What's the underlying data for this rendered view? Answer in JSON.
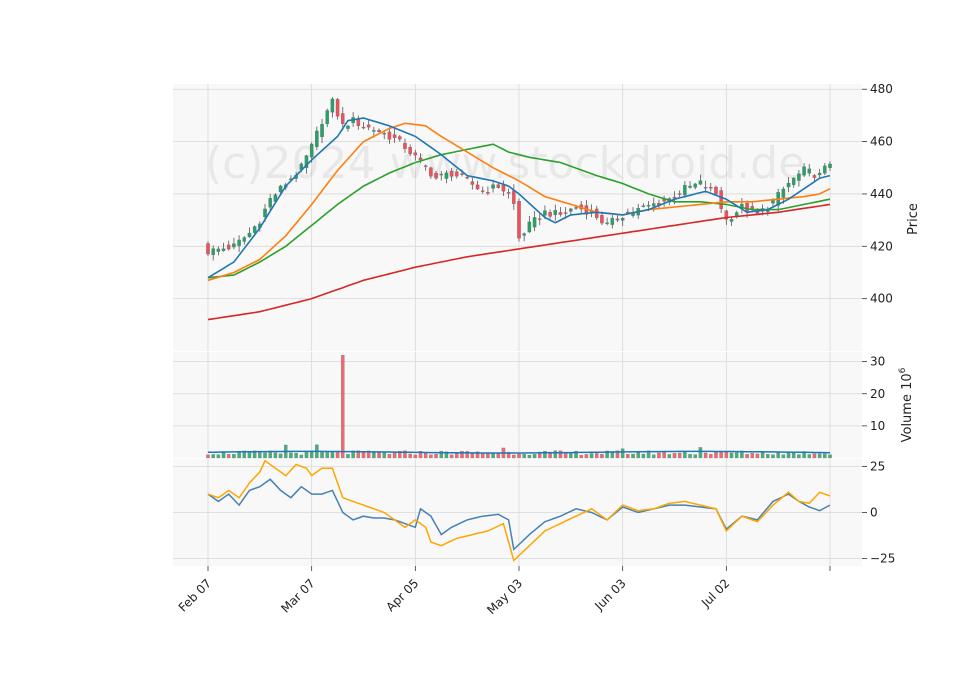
{
  "watermark": "(c)2024 www.stockdroid.de",
  "colors": {
    "up": "#26a269",
    "down": "#f0505a",
    "bg": "#f8f8f8",
    "grid": "#d8d8d8",
    "ma_blue": "#1f77b4",
    "ma_orange": "#ff7f0e",
    "ma_green": "#2ca02c",
    "ma_red": "#d62728",
    "osc_blue": "#4682b4",
    "osc_orange": "#ffa500",
    "vol_line": "#1f77b4"
  },
  "chart_data": [
    {
      "type": "candlestick",
      "ylabel": "Price",
      "ylim": [
        380,
        482
      ],
      "yticks": [
        400,
        420,
        440,
        460,
        480
      ],
      "xticks": [
        {
          "i": 0,
          "label": "Feb 07"
        },
        {
          "i": 20,
          "label": "Mar 07"
        },
        {
          "i": 40,
          "label": "Apr 05"
        },
        {
          "i": 60,
          "label": "May 03"
        },
        {
          "i": 80,
          "label": "Jun 03"
        },
        {
          "i": 100,
          "label": "Jul 02"
        },
        {
          "i": 120,
          "label": ""
        }
      ],
      "close_anchors": [
        [
          0,
          418
        ],
        [
          5,
          420
        ],
        [
          8,
          425
        ],
        [
          10,
          430
        ],
        [
          12,
          438
        ],
        [
          15,
          444
        ],
        [
          18,
          450
        ],
        [
          20,
          458
        ],
        [
          22,
          468
        ],
        [
          24,
          475
        ],
        [
          26,
          466
        ],
        [
          28,
          468
        ],
        [
          30,
          466
        ],
        [
          33,
          464
        ],
        [
          36,
          461
        ],
        [
          38,
          458
        ],
        [
          41,
          452
        ],
        [
          44,
          446
        ],
        [
          47,
          448
        ],
        [
          50,
          445
        ],
        [
          53,
          441
        ],
        [
          56,
          443
        ],
        [
          58,
          440
        ],
        [
          59,
          436
        ],
        [
          60,
          423
        ],
        [
          62,
          428
        ],
        [
          65,
          433
        ],
        [
          68,
          432
        ],
        [
          71,
          435
        ],
        [
          74,
          433
        ],
        [
          77,
          428
        ],
        [
          80,
          432
        ],
        [
          83,
          434
        ],
        [
          86,
          436
        ],
        [
          89,
          438
        ],
        [
          92,
          442
        ],
        [
          95,
          444
        ],
        [
          98,
          440
        ],
        [
          100,
          430
        ],
        [
          103,
          435
        ],
        [
          106,
          432
        ],
        [
          109,
          437
        ],
        [
          112,
          444
        ],
        [
          115,
          449
        ],
        [
          118,
          447
        ],
        [
          120,
          452
        ]
      ],
      "ma_blue": [
        [
          0,
          408
        ],
        [
          5,
          414
        ],
        [
          10,
          427
        ],
        [
          15,
          443
        ],
        [
          20,
          453
        ],
        [
          25,
          462
        ],
        [
          27,
          468
        ],
        [
          30,
          469
        ],
        [
          35,
          466
        ],
        [
          40,
          462
        ],
        [
          45,
          455
        ],
        [
          50,
          447
        ],
        [
          55,
          445
        ],
        [
          58,
          443
        ],
        [
          60,
          440
        ],
        [
          65,
          431
        ],
        [
          67,
          429
        ],
        [
          70,
          432
        ],
        [
          75,
          433
        ],
        [
          80,
          432
        ],
        [
          85,
          434
        ],
        [
          90,
          438
        ],
        [
          96,
          441
        ],
        [
          100,
          438
        ],
        [
          104,
          433
        ],
        [
          108,
          434
        ],
        [
          112,
          438
        ],
        [
          115,
          442
        ],
        [
          118,
          446
        ],
        [
          120,
          447
        ]
      ],
      "ma_orange": [
        [
          0,
          407
        ],
        [
          5,
          410
        ],
        [
          10,
          415
        ],
        [
          15,
          424
        ],
        [
          20,
          436
        ],
        [
          25,
          449
        ],
        [
          30,
          460
        ],
        [
          35,
          465
        ],
        [
          38,
          467
        ],
        [
          42,
          466
        ],
        [
          45,
          462
        ],
        [
          50,
          456
        ],
        [
          55,
          450
        ],
        [
          60,
          445
        ],
        [
          65,
          439
        ],
        [
          70,
          436
        ],
        [
          75,
          433
        ],
        [
          80,
          432
        ],
        [
          85,
          434
        ],
        [
          90,
          435
        ],
        [
          95,
          436
        ],
        [
          100,
          437
        ],
        [
          105,
          437
        ],
        [
          110,
          438
        ],
        [
          115,
          439
        ],
        [
          118,
          440
        ],
        [
          120,
          442
        ]
      ],
      "ma_green": [
        [
          0,
          408
        ],
        [
          5,
          409
        ],
        [
          10,
          414
        ],
        [
          15,
          420
        ],
        [
          20,
          428
        ],
        [
          25,
          436
        ],
        [
          30,
          443
        ],
        [
          35,
          448
        ],
        [
          40,
          452
        ],
        [
          45,
          455
        ],
        [
          50,
          457
        ],
        [
          55,
          459
        ],
        [
          58,
          456
        ],
        [
          62,
          454
        ],
        [
          68,
          452
        ],
        [
          75,
          447
        ],
        [
          80,
          444
        ],
        [
          85,
          440
        ],
        [
          90,
          437
        ],
        [
          95,
          437
        ],
        [
          100,
          436
        ],
        [
          105,
          434
        ],
        [
          110,
          434
        ],
        [
          115,
          436
        ],
        [
          120,
          438
        ]
      ],
      "ma_red": [
        [
          0,
          392
        ],
        [
          10,
          395
        ],
        [
          20,
          400
        ],
        [
          30,
          407
        ],
        [
          40,
          412
        ],
        [
          50,
          416
        ],
        [
          60,
          419
        ],
        [
          70,
          422
        ],
        [
          80,
          425
        ],
        [
          90,
          428
        ],
        [
          100,
          431
        ],
        [
          110,
          433
        ],
        [
          120,
          436
        ]
      ]
    },
    {
      "type": "bar",
      "ylabel": "Volume  10",
      "ylabel_exp": "6",
      "ylim": [
        0,
        33
      ],
      "yticks": [
        10,
        20,
        30
      ],
      "spike": {
        "i": 26,
        "value": 32
      },
      "ma_level": 1.8
    },
    {
      "type": "line",
      "ylim": [
        -29,
        29
      ],
      "yticks": [
        -25,
        0,
        25
      ],
      "yticklabels": [
        "−25",
        "0",
        "25"
      ],
      "series": [
        {
          "color": "osc_blue",
          "anchors": [
            [
              0,
              10
            ],
            [
              2,
              6
            ],
            [
              4,
              10
            ],
            [
              6,
              4
            ],
            [
              8,
              12
            ],
            [
              10,
              14
            ],
            [
              12,
              18
            ],
            [
              14,
              12
            ],
            [
              16,
              8
            ],
            [
              18,
              14
            ],
            [
              20,
              10
            ],
            [
              22,
              10
            ],
            [
              24,
              12
            ],
            [
              26,
              0
            ],
            [
              28,
              -4
            ],
            [
              30,
              -2
            ],
            [
              32,
              -3
            ],
            [
              34,
              -3
            ],
            [
              36,
              -4
            ],
            [
              38,
              -6
            ],
            [
              40,
              -8
            ],
            [
              41,
              2
            ],
            [
              43,
              -2
            ],
            [
              45,
              -12
            ],
            [
              47,
              -8
            ],
            [
              50,
              -4
            ],
            [
              53,
              -2
            ],
            [
              56,
              -1
            ],
            [
              58,
              -4
            ],
            [
              59,
              -20
            ],
            [
              62,
              -12
            ],
            [
              65,
              -5
            ],
            [
              68,
              -2
            ],
            [
              71,
              2
            ],
            [
              74,
              0
            ],
            [
              77,
              -4
            ],
            [
              80,
              3
            ],
            [
              83,
              0
            ],
            [
              86,
              2
            ],
            [
              89,
              4
            ],
            [
              92,
              4
            ],
            [
              95,
              3
            ],
            [
              98,
              2
            ],
            [
              100,
              -9
            ],
            [
              103,
              -2
            ],
            [
              106,
              -4
            ],
            [
              109,
              6
            ],
            [
              112,
              10
            ],
            [
              114,
              6
            ],
            [
              116,
              3
            ],
            [
              118,
              1
            ],
            [
              120,
              4
            ]
          ]
        },
        {
          "color": "osc_orange",
          "anchors": [
            [
              0,
              10
            ],
            [
              2,
              8
            ],
            [
              4,
              12
            ],
            [
              6,
              8
            ],
            [
              8,
              16
            ],
            [
              10,
              22
            ],
            [
              11,
              28
            ],
            [
              13,
              24
            ],
            [
              15,
              20
            ],
            [
              17,
              26
            ],
            [
              19,
              24
            ],
            [
              20,
              20
            ],
            [
              22,
              24
            ],
            [
              24,
              24
            ],
            [
              26,
              8
            ],
            [
              28,
              6
            ],
            [
              30,
              4
            ],
            [
              32,
              2
            ],
            [
              34,
              0
            ],
            [
              36,
              -4
            ],
            [
              38,
              -8
            ],
            [
              40,
              -4
            ],
            [
              42,
              -8
            ],
            [
              43,
              -16
            ],
            [
              45,
              -18
            ],
            [
              48,
              -14
            ],
            [
              51,
              -12
            ],
            [
              54,
              -10
            ],
            [
              57,
              -6
            ],
            [
              59,
              -26
            ],
            [
              62,
              -18
            ],
            [
              65,
              -10
            ],
            [
              68,
              -6
            ],
            [
              71,
              -2
            ],
            [
              74,
              2
            ],
            [
              77,
              -4
            ],
            [
              80,
              4
            ],
            [
              83,
              1
            ],
            [
              86,
              2
            ],
            [
              89,
              5
            ],
            [
              92,
              6
            ],
            [
              95,
              4
            ],
            [
              98,
              2
            ],
            [
              100,
              -10
            ],
            [
              103,
              -2
            ],
            [
              106,
              -5
            ],
            [
              109,
              4
            ],
            [
              112,
              11
            ],
            [
              114,
              6
            ],
            [
              116,
              5
            ],
            [
              118,
              11
            ],
            [
              120,
              9
            ]
          ]
        }
      ]
    }
  ]
}
